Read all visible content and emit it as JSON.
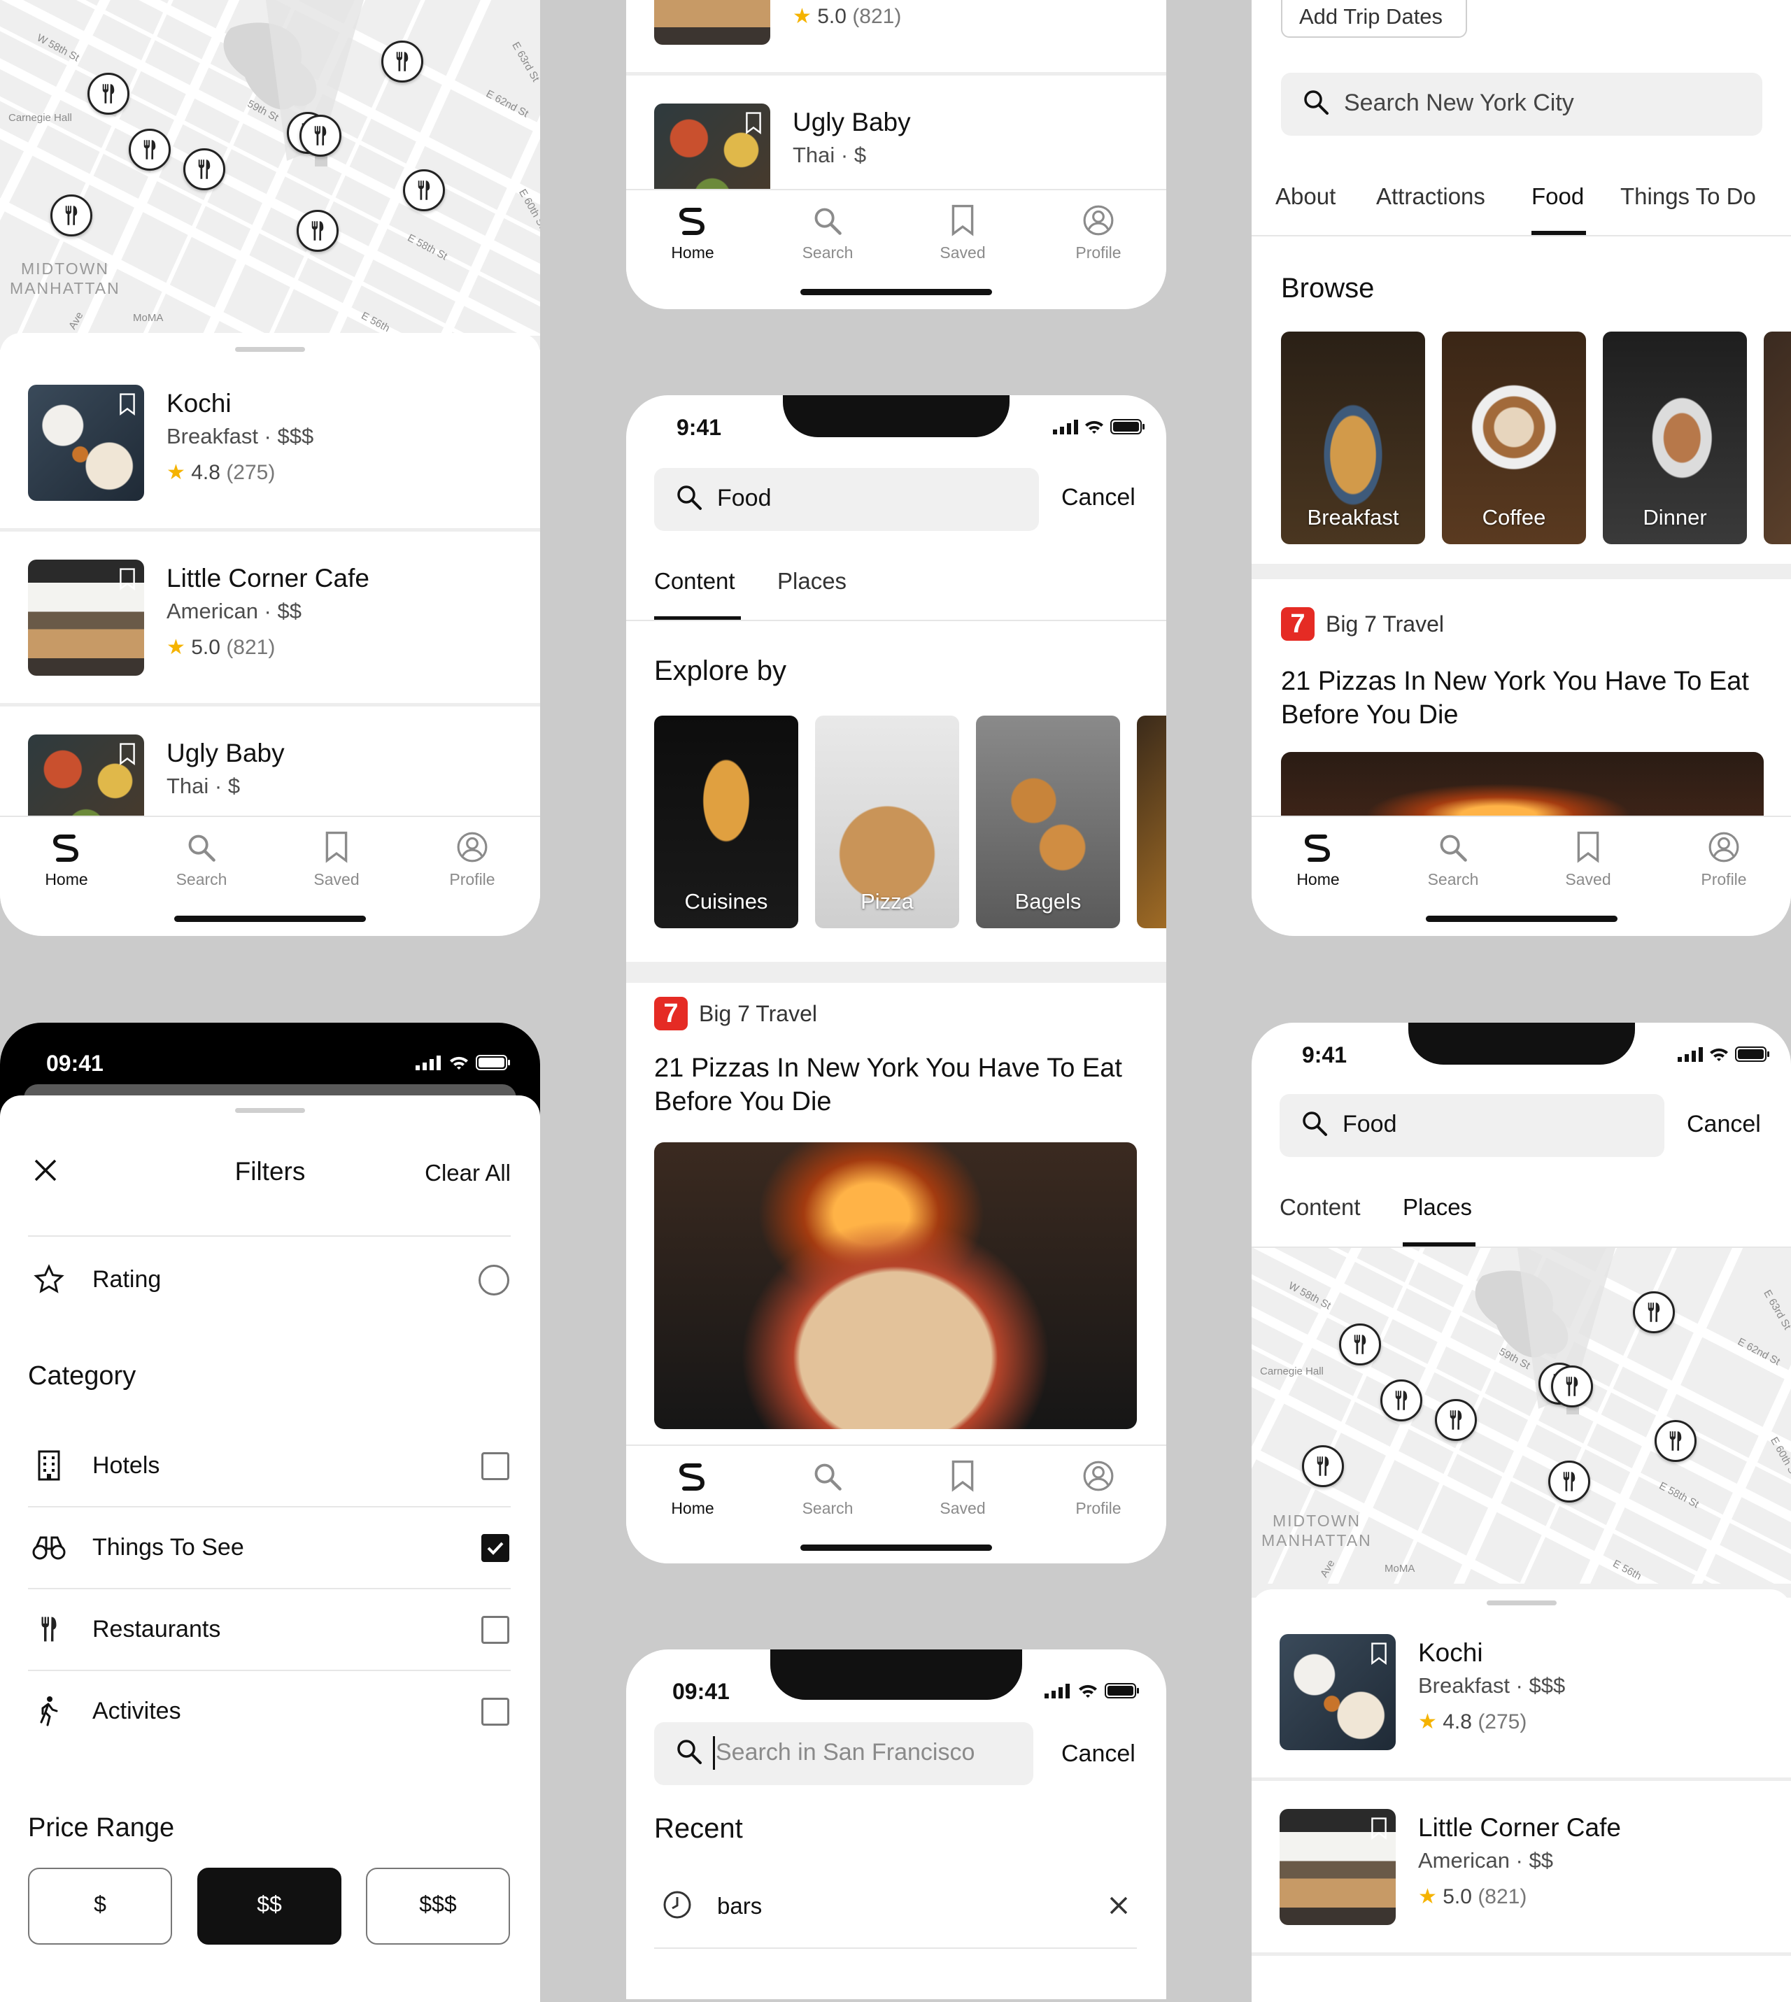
{
  "colors": {
    "background": "#cbcbcb",
    "accent": "#111111",
    "star": "#f5b300",
    "brand_logo": "#e52b24"
  },
  "tabbar": {
    "home": "Home",
    "search": "Search",
    "saved": "Saved",
    "profile": "Profile"
  },
  "map": {
    "streets": [
      "W 58th St",
      "59th St",
      "E 63rd St",
      "E 62nd St",
      "E 60th St",
      "E 58th St",
      "E 56th",
      "Ave"
    ],
    "places": [
      "Carnegie Hall",
      "MoMA"
    ],
    "area_line1": "MIDTOWN",
    "area_line2": "MANHATTAN"
  },
  "restaurants": [
    {
      "name": "Kochi",
      "category": "Breakfast · $$$",
      "rating": "4.8",
      "count": "(275)"
    },
    {
      "name": "Little Corner Cafe",
      "category": "American · $$",
      "rating": "5.0",
      "count": "(821)"
    },
    {
      "name": "Ugly Baby",
      "category": "Thai · $",
      "rating": "",
      "count": ""
    }
  ],
  "search_content": {
    "time": "9:41",
    "query": "Food",
    "cancel": "Cancel",
    "tabs": [
      "Content",
      "Places"
    ],
    "section": "Explore by",
    "tiles": [
      "Cuisines",
      "Pizza",
      "Bagels"
    ],
    "article": {
      "source": "Big 7 Travel",
      "logo": "7",
      "title_line1": "21 Pizzas In New York You Have To Eat",
      "title_line2": "Before You Die"
    }
  },
  "recent_search": {
    "time": "09:41",
    "placeholder": "Search in San Francisco",
    "cancel": "Cancel",
    "section": "Recent",
    "items": [
      "bars"
    ]
  },
  "city_guide": {
    "add_dates": "Add Trip Dates",
    "search_placeholder": "Search New York City",
    "tabs": [
      "About",
      "Attractions",
      "Food",
      "Things To Do"
    ],
    "section": "Browse",
    "tiles": [
      "Breakfast",
      "Coffee",
      "Dinner"
    ],
    "article": {
      "source": "Big 7 Travel",
      "logo": "7",
      "title_line1": "21 Pizzas In New York You Have To Eat",
      "title_line2": "Before You Die"
    }
  },
  "filters": {
    "time": "09:41",
    "title": "Filters",
    "clear": "Clear All",
    "rating": "Rating",
    "category_title": "Category",
    "categories": [
      {
        "label": "Hotels",
        "checked": false
      },
      {
        "label": "Things To See",
        "checked": true
      },
      {
        "label": "Restaurants",
        "checked": false
      },
      {
        "label": "Activites",
        "checked": false
      }
    ],
    "price_title": "Price Range",
    "prices": [
      "$",
      "$$",
      "$$$"
    ],
    "price_selected": "$$"
  },
  "places_search": {
    "time": "9:41",
    "query": "Food",
    "cancel": "Cancel",
    "tabs": [
      "Content",
      "Places"
    ]
  }
}
